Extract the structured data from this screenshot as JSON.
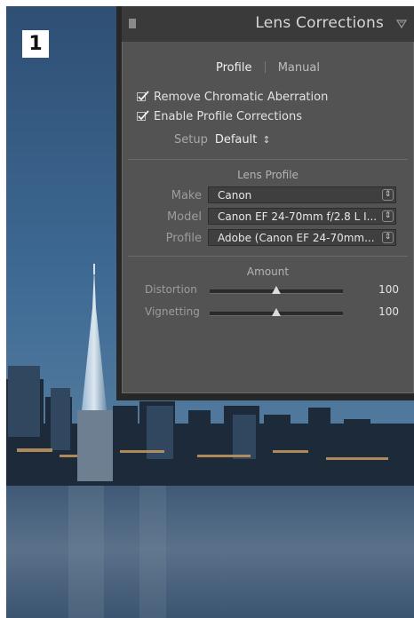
{
  "step_number": "1",
  "panel": {
    "title": "Lens Corrections",
    "tabs": [
      {
        "label": "Profile",
        "active": true
      },
      {
        "label": "Manual",
        "active": false
      }
    ],
    "checkboxes": [
      {
        "label": "Remove Chromatic Aberration",
        "checked": true
      },
      {
        "label": "Enable Profile Corrections",
        "checked": true
      }
    ],
    "setup": {
      "label": "Setup",
      "value": "Default",
      "spinner": "↕"
    },
    "lens_profile": {
      "title": "Lens Profile",
      "fields": [
        {
          "label": "Make",
          "value": "Canon"
        },
        {
          "label": "Model",
          "value": "Canon EF 24-70mm f/2.8 L I..."
        },
        {
          "label": "Profile",
          "value": "Adobe (Canon EF 24-70mm..."
        }
      ]
    },
    "amount": {
      "title": "Amount",
      "sliders": [
        {
          "label": "Distortion",
          "value": "100",
          "level": 0.5
        },
        {
          "label": "Vignetting",
          "value": "100",
          "level": 0.5
        }
      ]
    }
  }
}
